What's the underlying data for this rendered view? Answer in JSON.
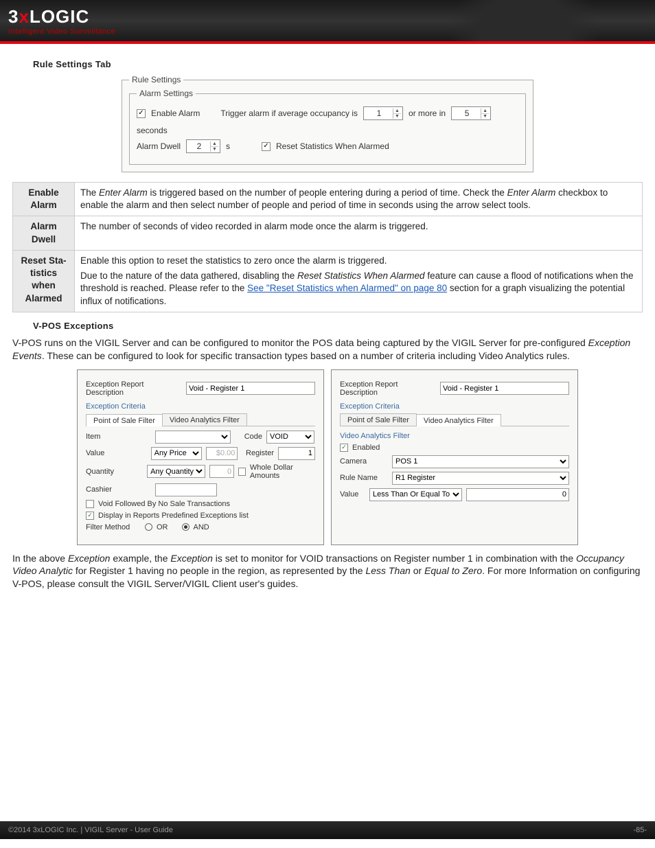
{
  "header": {
    "logo_main_pre": "3",
    "logo_main_x": "x",
    "logo_main_post": "LOGIC",
    "logo_sub": "Intelligent Video Surveillance"
  },
  "sections": {
    "rule_settings": "Rule Settings Tab",
    "vpos": "V-POS Exceptions"
  },
  "rule_fig": {
    "rule_legend": "Rule Settings",
    "alarm_legend": "Alarm Settings",
    "enable_alarm_label": "Enable Alarm",
    "trigger_text_a": "Trigger alarm if average occupancy is",
    "trigger_val": "1",
    "trigger_text_b": "or more in",
    "trigger_seconds": "5",
    "trigger_text_c": "seconds",
    "dwell_label": "Alarm Dwell",
    "dwell_val": "2",
    "dwell_unit": "s",
    "reset_label": "Reset Statistics When Alarmed"
  },
  "defs": {
    "enable_alarm_term": "Enable Alarm",
    "enable_alarm_desc_a": "The ",
    "enable_alarm_em1": "Enter Alarm",
    "enable_alarm_desc_b": " is triggered based on the number of people entering during a period of time. Check the ",
    "enable_alarm_em2": "Enter Alarm",
    "enable_alarm_desc_c": " checkbox to enable the alarm and then select number of people and period of time in seconds using the arrow select tools.",
    "alarm_dwell_term": "Alarm Dwell",
    "alarm_dwell_desc": "The number of seconds of video recorded in alarm mode once the alarm is triggered.",
    "reset_term": "Reset Sta-\ntistics when Alarmed",
    "reset_desc_a": "Enable this option to reset the statistics to zero once the alarm is triggered.",
    "reset_desc_b": "Due to the nature of the data gathered, disabling the ",
    "reset_em": "Reset Statistics When Alarmed",
    "reset_desc_c": " feature can cause a flood of notifications when the threshold is reached.  Please refer to the ",
    "reset_link": "See \"Reset Statistics when Alarmed\" on page 80",
    "reset_desc_d": " section for a graph visualizing the potential influx of notifications."
  },
  "vpos_intro_a": "V-POS runs on the VIGIL Server and can be configured to monitor the POS data being captured by the VIGIL Server for pre-configured ",
  "vpos_intro_em": "Exception Events",
  "vpos_intro_b": ".  These can be configured to look for specific transaction types based on a number of criteria including Video Analytics rules.",
  "panelA": {
    "desc_label": "Exception Report Description",
    "desc_val": "Void - Register 1",
    "criteria_title": "Exception Criteria",
    "tab1": "Point of Sale Filter",
    "tab2": "Video Analytics Filter",
    "item_lbl": "Item",
    "item_val": "",
    "code_lbl": "Code",
    "code_val": "VOID",
    "value_lbl": "Value",
    "value_sel": "Any Price",
    "value_amt": "$0.00",
    "register_lbl": "Register",
    "register_val": "1",
    "qty_lbl": "Quantity",
    "qty_sel": "Any Quantity",
    "qty_val": "0",
    "whole_lbl": "Whole Dollar Amounts",
    "cashier_lbl": "Cashier",
    "cashier_val": "",
    "void_follow_lbl": "Void Followed By No Sale Transactions",
    "display_lbl": "Display in Reports Predefined Exceptions list",
    "filter_method_lbl": "Filter Method",
    "or_lbl": "OR",
    "and_lbl": "AND"
  },
  "panelB": {
    "desc_label": "Exception Report Description",
    "desc_val": "Void - Register 1",
    "criteria_title": "Exception Criteria",
    "tab1": "Point of Sale Filter",
    "tab2": "Video Analytics Filter",
    "vaf_title": "Video Analytics Filter",
    "enabled_lbl": "Enabled",
    "camera_lbl": "Camera",
    "camera_val": "POS 1",
    "rule_lbl": "Rule Name",
    "rule_val": "R1 Register",
    "value_lbl": "Value",
    "value_sel": "Less Than Or Equal To",
    "value_val": "0"
  },
  "outro_a": "In the above ",
  "outro_em1": "Exception",
  "outro_b": " example, the ",
  "outro_em2": "Exception",
  "outro_c": " is set to monitor for VOID transactions on Register number 1 in combination with the ",
  "outro_em3": "Occupancy Video Analytic",
  "outro_d": " for Register 1 having no people in the region, as represented by the ",
  "outro_em4": "Less Than",
  "outro_e": " or ",
  "outro_em5": "Equal to Zero",
  "outro_f": ".  For more Information on configuring V-POS, please consult the VIGIL Server/VIGIL Client user's guides.",
  "footer": {
    "left": "©2014 3xLOGIC Inc.  |  VIGIL Server - User Guide",
    "right": "-85-"
  }
}
